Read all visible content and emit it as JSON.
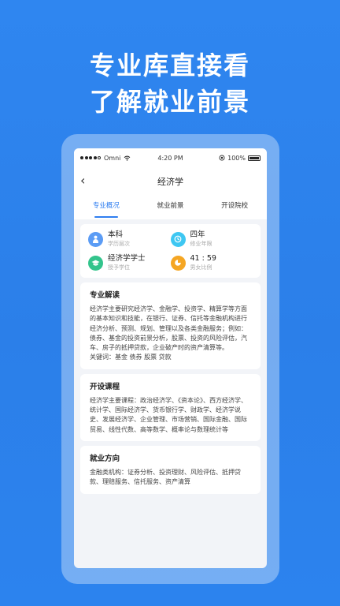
{
  "headline": {
    "line1": "专业库直接看",
    "line2": "了解就业前景"
  },
  "status_bar": {
    "carrier": "Omni",
    "time": "4:20 PM",
    "battery": "100%"
  },
  "nav": {
    "back": "‹",
    "title": "经济学"
  },
  "tabs": [
    {
      "label": "专业概况",
      "active": true
    },
    {
      "label": "就业前景",
      "active": false
    },
    {
      "label": "开设院校",
      "active": false
    }
  ],
  "stats": [
    {
      "value": "本科",
      "label": "学历层次",
      "icon": "person-icon",
      "color": "#5b9cf5"
    },
    {
      "value": "四年",
      "label": "修业年限",
      "icon": "clock-icon",
      "color": "#3ec7f2"
    },
    {
      "value": "经济学学士",
      "label": "授予学位",
      "icon": "graduation-cap-icon",
      "color": "#33c48c"
    },
    {
      "value": "41 : 59",
      "label": "男女比例",
      "icon": "pie-chart-icon",
      "color": "#f5a623"
    }
  ],
  "sections": [
    {
      "title": "专业解读",
      "body": "经济学主要研究经济学、金融学、投资学、精算学等方面的基本知识和技能，在银行、证券、信托等金融机构进行经济分析、预测、规划、管理以及各类金融服务；例如：债券、基金的投资前景分析，股票、投资的风险评估，汽车、房子的抵押贷款，企业破产时的资产清算等。",
      "keywords": "关键词：基金 债券 股票 贷款"
    },
    {
      "title": "开设课程",
      "body": "经济学主要课程：政治经济学、《资本论》、西方经济学、统计学、国际经济学、货币银行学、财政学、经济学说史、发展经济学、企业管理、市场营销、国际金融、国际贸易、线性代数、高等数学、概率论与数理统计等"
    },
    {
      "title": "就业方向",
      "body": "金融类机构：证券分析、投资理财、风险评估、抵押贷款、理赔服务、信托服务、资产清算"
    }
  ]
}
